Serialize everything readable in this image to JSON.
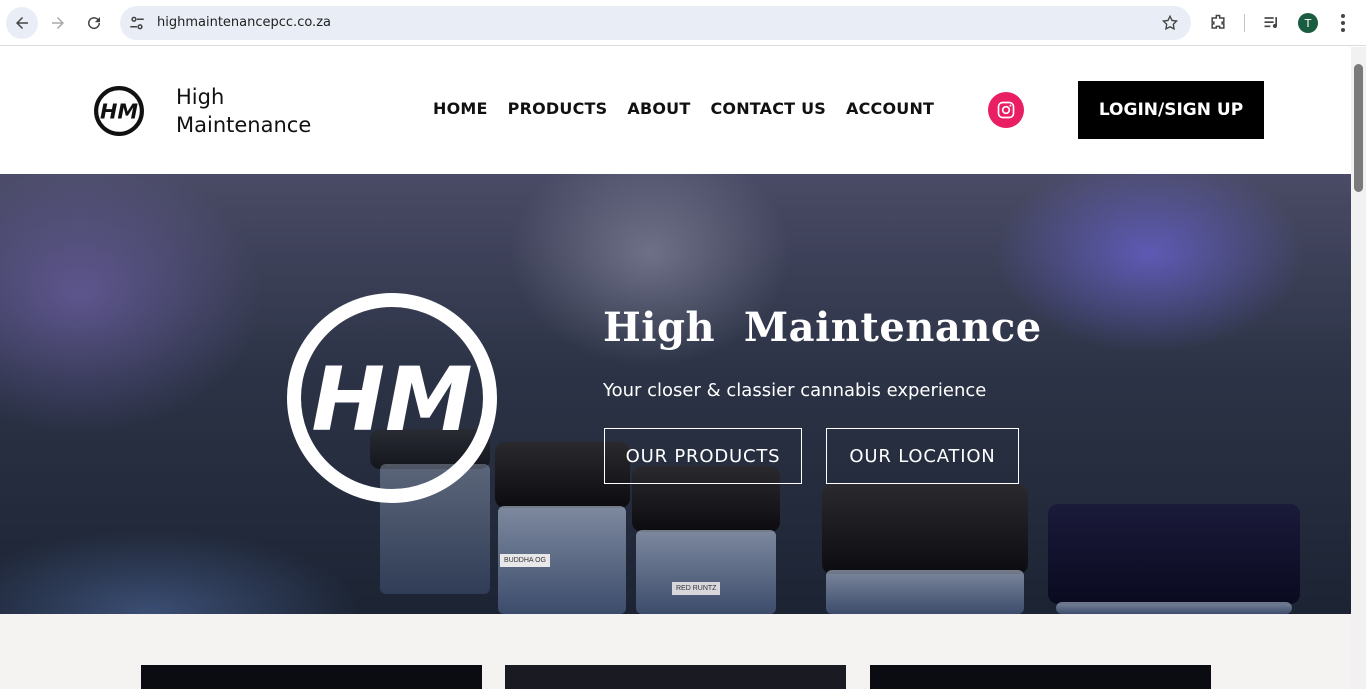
{
  "browser": {
    "url": "highmaintenancepcc.co.za",
    "profile_initial": "T"
  },
  "site": {
    "brand_line1": "High",
    "brand_line2": "Maintenance",
    "nav": [
      "HOME",
      "PRODUCTS",
      "ABOUT",
      "CONTACT US",
      "ACCOUNT"
    ],
    "login_label": "LOGIN/SIGN UP",
    "instagram_color": "#e91e63"
  },
  "hero": {
    "logo_text": "HM",
    "title": "High  Maintenance",
    "subtitle": "Your closer & classier cannabis experience",
    "buttons": [
      "OUR PRODUCTS",
      "OUR LOCATION"
    ],
    "jar_labels": [
      "BUDDHA OG",
      "RED RUNTZ"
    ]
  },
  "icons": [
    "back-arrow-icon",
    "forward-arrow-icon",
    "reload-icon",
    "site-settings-icon",
    "bookmark-star-icon",
    "extensions-icon",
    "media-icon",
    "menu-kebab-icon",
    "instagram-icon"
  ]
}
